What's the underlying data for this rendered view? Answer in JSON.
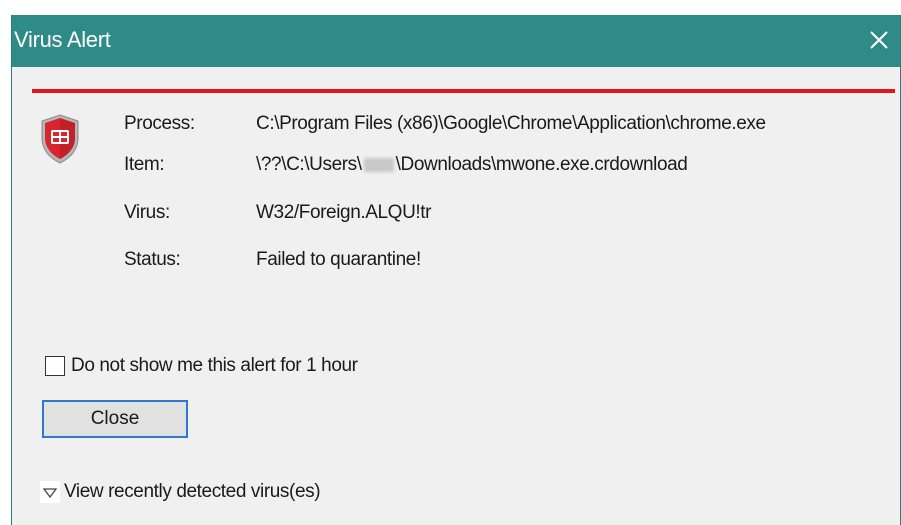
{
  "window": {
    "title": "Virus Alert",
    "close_icon": "close-icon"
  },
  "colors": {
    "titlebar": "#2e8b87",
    "alert_line": "#e8141b",
    "focus_border": "#2f78cf",
    "shield_red": "#d7262e",
    "shield_dark_red": "#9a1b20",
    "shield_gray": "#b7b7b7"
  },
  "details": {
    "icon": "shield-icon",
    "process_label": "Process:",
    "process_value": "C:\\Program Files (x86)\\Google\\Chrome\\Application\\chrome.exe",
    "item_label": "Item:",
    "item_value_prefix": "\\??\\C:\\Users\\",
    "item_value_suffix": "\\Downloads\\mwone.exe.crdownload",
    "virus_label": "Virus:",
    "virus_value": "W32/Foreign.ALQU!tr",
    "status_label": "Status:",
    "status_value": "Failed to quarantine!"
  },
  "options": {
    "hide_alert_label": "Do not show me this alert for 1 hour",
    "hide_alert_checked": false
  },
  "buttons": {
    "close_label": "Close"
  },
  "footer": {
    "expander_icon": "triangle-down-icon",
    "view_recent_label": "View recently detected virus(es)"
  }
}
